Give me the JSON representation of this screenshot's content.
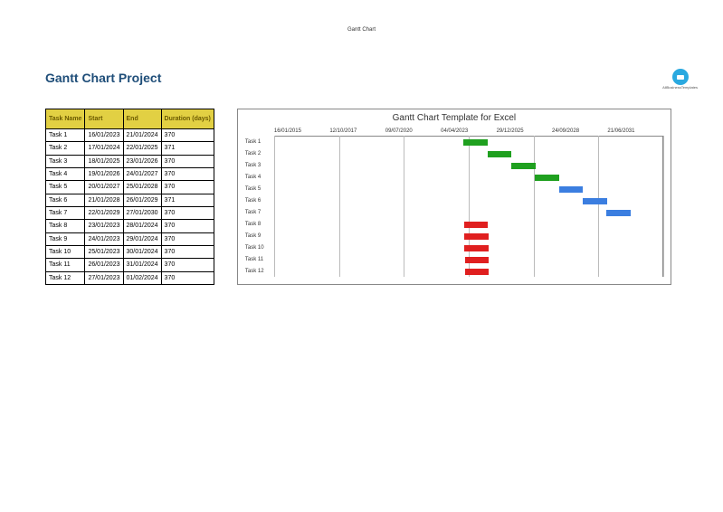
{
  "header_tiny": "Gantt Chart",
  "title": "Gantt Chart Project",
  "logo_text": "AllBusinessTemplates",
  "table": {
    "headers": [
      "Task Name",
      "Start",
      "End",
      "Duration (days)"
    ],
    "rows": [
      [
        "Task 1",
        "16/01/2023",
        "21/01/2024",
        "370"
      ],
      [
        "Task 2",
        "17/01/2024",
        "22/01/2025",
        "371"
      ],
      [
        "Task 3",
        "18/01/2025",
        "23/01/2026",
        "370"
      ],
      [
        "Task 4",
        "19/01/2026",
        "24/01/2027",
        "370"
      ],
      [
        "Task 5",
        "20/01/2027",
        "25/01/2028",
        "370"
      ],
      [
        "Task 6",
        "21/01/2028",
        "26/01/2029",
        "371"
      ],
      [
        "Task 7",
        "22/01/2029",
        "27/01/2030",
        "370"
      ],
      [
        "Task 8",
        "23/01/2023",
        "28/01/2024",
        "370"
      ],
      [
        "Task 9",
        "24/01/2023",
        "29/01/2024",
        "370"
      ],
      [
        "Task 10",
        "25/01/2023",
        "30/01/2024",
        "370"
      ],
      [
        "Task 11",
        "26/01/2023",
        "31/01/2024",
        "370"
      ],
      [
        "Task 12",
        "27/01/2023",
        "01/02/2024",
        "370"
      ]
    ]
  },
  "chart_data": {
    "type": "gantt",
    "title": "Gantt Chart Template for Excel",
    "xticks": [
      "16/01/2015",
      "12/10/2017",
      "09/07/2020",
      "04/04/2023",
      "29/12/2025",
      "24/09/2028",
      "21/06/2031"
    ],
    "xrange_days": 6000,
    "x_start": "16/01/2015",
    "tasks": [
      {
        "name": "Task 1",
        "offset_pct": 48.7,
        "width_pct": 6.2,
        "color": "green"
      },
      {
        "name": "Task 2",
        "offset_pct": 54.8,
        "width_pct": 6.2,
        "color": "green"
      },
      {
        "name": "Task 3",
        "offset_pct": 61.0,
        "width_pct": 6.2,
        "color": "green"
      },
      {
        "name": "Task 4",
        "offset_pct": 67.1,
        "width_pct": 6.2,
        "color": "green"
      },
      {
        "name": "Task 5",
        "offset_pct": 73.2,
        "width_pct": 6.2,
        "color": "blue"
      },
      {
        "name": "Task 6",
        "offset_pct": 79.3,
        "width_pct": 6.2,
        "color": "blue"
      },
      {
        "name": "Task 7",
        "offset_pct": 85.4,
        "width_pct": 6.2,
        "color": "blue"
      },
      {
        "name": "Task 8",
        "offset_pct": 48.8,
        "width_pct": 6.2,
        "color": "red"
      },
      {
        "name": "Task 9",
        "offset_pct": 48.9,
        "width_pct": 6.2,
        "color": "red"
      },
      {
        "name": "Task 10",
        "offset_pct": 48.9,
        "width_pct": 6.2,
        "color": "red"
      },
      {
        "name": "Task 11",
        "offset_pct": 49.0,
        "width_pct": 6.2,
        "color": "red"
      },
      {
        "name": "Task 12",
        "offset_pct": 49.0,
        "width_pct": 6.2,
        "color": "red"
      }
    ]
  }
}
